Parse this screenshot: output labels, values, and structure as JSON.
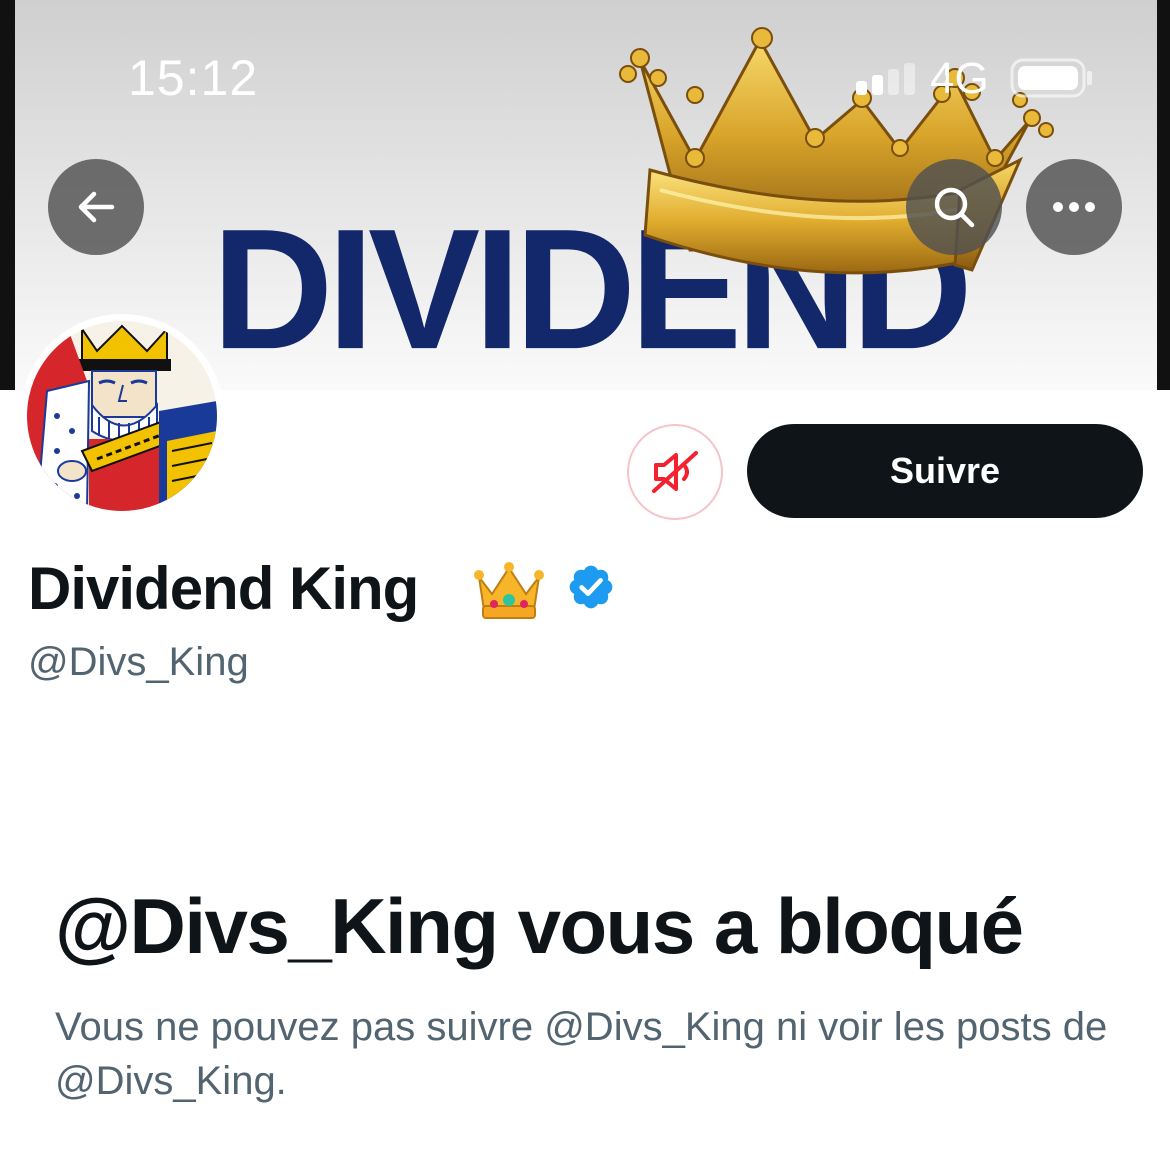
{
  "status_bar": {
    "time": "15:12",
    "network": "4G"
  },
  "banner": {
    "text": "DIVIDEND",
    "text_color": "#13276b"
  },
  "header_buttons": {
    "back_icon": "arrow-left-icon",
    "search_icon": "search-icon",
    "more_icon": "more-horizontal-icon"
  },
  "profile": {
    "display_name": "Dividend King",
    "name_emoji": "crown-emoji",
    "verified": true,
    "verified_color": "#1d9bf0",
    "handle": "@Divs_King",
    "avatar": "king-playing-card"
  },
  "actions": {
    "mute_icon": "speaker-muted-icon",
    "mute_color": "#f4212e",
    "follow_label": "Suivre"
  },
  "blocked": {
    "title": "@Divs_King vous a bloqué",
    "description": "Vous ne pouvez pas suivre @Divs_King ni voir les posts de @Divs_King."
  }
}
